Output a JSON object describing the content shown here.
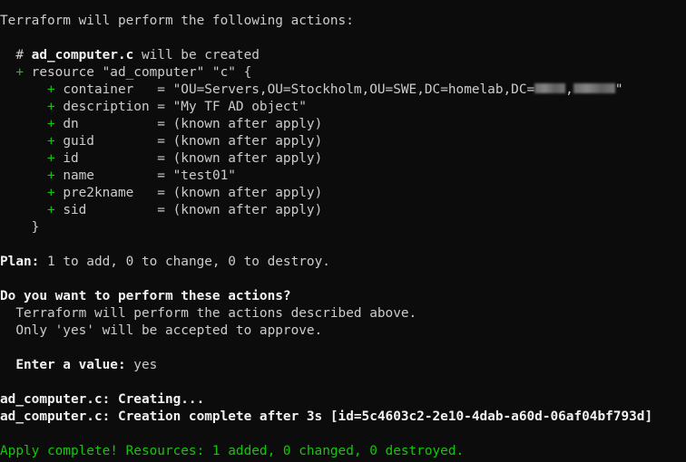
{
  "terminal": {
    "header": "Terraform will perform the following actions:",
    "resource_comment_prefix": "  # ",
    "resource_address": "ad_computer.c",
    "resource_comment_suffix": " will be created",
    "plus": "+",
    "resource_block_open": " resource \"ad_computer\" \"c\" {",
    "attributes": [
      {
        "name": " container   = ",
        "value": "\"OU=Servers,OU=Stockholm,OU=SWE,DC=homelab,DC=",
        "redacted": true,
        "tail": "\""
      },
      {
        "name": " description = ",
        "value": "\"My TF AD object\""
      },
      {
        "name": " dn          = ",
        "value": "(known after apply)"
      },
      {
        "name": " guid        = ",
        "value": "(known after apply)"
      },
      {
        "name": " id          = ",
        "value": "(known after apply)"
      },
      {
        "name": " name        = ",
        "value": "\"test01\""
      },
      {
        "name": " pre2kname   = ",
        "value": "(known after apply)"
      },
      {
        "name": " sid         = ",
        "value": "(known after apply)"
      }
    ],
    "block_close": "    }",
    "plan_label": "Plan:",
    "plan_text": " 1 to add, 0 to change, 0 to destroy.",
    "prompt_question": "Do you want to perform these actions?",
    "prompt_line1": "  Terraform will perform the actions described above.",
    "prompt_line2": "  Only 'yes' will be accepted to approve.",
    "enter_label": "  Enter a value:",
    "enter_value": " yes",
    "creating": "ad_computer.c: Creating...",
    "creation_complete": "ad_computer.c: Creation complete after 3s [id=5c4603c2-2e10-4dab-a60d-06af04bf793d]",
    "apply_complete": "Apply complete! Resources: 1 added, 0 changed, 0 destroyed."
  },
  "colors": {
    "background": "#0c0c0c",
    "text": "#cccccc",
    "bold": "#f2f2f2",
    "green": "#16c60c"
  }
}
